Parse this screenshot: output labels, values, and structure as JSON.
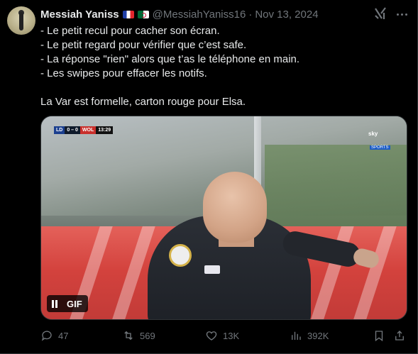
{
  "author": {
    "name": "Messiah Yaniss",
    "flags": [
      "flag-france-icon",
      "flag-algeria-icon"
    ],
    "handle": "@MessiahYaniss16",
    "separator": "·",
    "date": "Nov 13, 2024"
  },
  "tweet": {
    "lines": [
      "- Le petit recul pour cacher son écran.",
      "- Le petit regard pour vérifier que c’est safe.",
      "- La réponse \"rien\" alors que t’as le téléphone en main.",
      "- Les swipes pour effacer les notifs."
    ],
    "closing": "La Var est formelle, carton rouge pour Elsa."
  },
  "media": {
    "type": "gif",
    "badge_label": "GIF",
    "scorebug": {
      "team1": "LD",
      "score": "0 – 0",
      "team2": "WOL",
      "time": "13:29"
    },
    "broadcaster": {
      "name": "sky",
      "tag": "SPORTS"
    }
  },
  "actions": {
    "replies": "47",
    "reposts": "569",
    "likes": "13K",
    "views": "392K"
  },
  "colors": {
    "background": "#000000",
    "text": "#e7e9ea",
    "muted": "#71767b",
    "border": "#2f3336"
  }
}
